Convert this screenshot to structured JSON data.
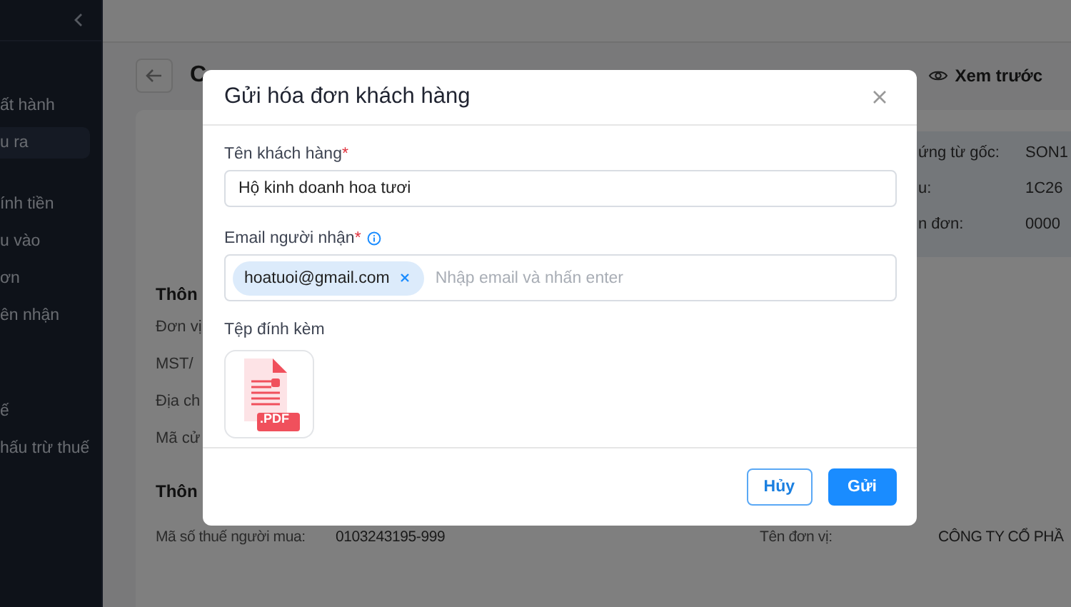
{
  "sidebar": {
    "groups": [
      {
        "items": [
          {
            "label": "ất hành",
            "selected": false
          },
          {
            "label": "u ra",
            "selected": true
          }
        ]
      },
      {
        "items": [
          {
            "label": "ính tiền",
            "selected": false
          },
          {
            "label": "u vào",
            "selected": false
          },
          {
            "label": "ơn",
            "selected": false
          },
          {
            "label": "ên nhận",
            "selected": false
          }
        ]
      },
      {
        "items": [
          {
            "label": "ế",
            "selected": false
          },
          {
            "label": "hấu trừ thuế",
            "selected": false
          }
        ]
      }
    ]
  },
  "page": {
    "title": "C",
    "preview_button": "Xem trước",
    "info_card": {
      "rows": [
        {
          "label": "ứng từ gốc:",
          "value": "SON1"
        },
        {
          "label": "u:",
          "value": "1C26"
        },
        {
          "label": "n đơn:",
          "value": "0000"
        }
      ]
    },
    "sections": [
      {
        "heading": "Thôn",
        "rows": [
          {
            "label": "Đơn vị"
          },
          {
            "label": "MST/"
          },
          {
            "label": "Địa ch"
          },
          {
            "label": "Mã cử"
          }
        ]
      },
      {
        "heading": "Thôn",
        "rows": [
          {
            "label": "Mã số thuế người mua:",
            "value": "0103243195-999",
            "label_2": "Tên đơn vị:",
            "value_2": "CÔNG TY CỔ PHẦ"
          }
        ]
      }
    ]
  },
  "modal": {
    "title": "Gửi hóa đơn khách hàng",
    "fields": [
      {
        "kind": "text",
        "label": "Tên khách hàng",
        "required_mark": "*",
        "value": "Hộ kinh doanh hoa tươi"
      },
      {
        "kind": "tags",
        "label": "Email người nhận",
        "required_mark": "*",
        "info": true,
        "tags": [
          "hoatuoi@gmail.com"
        ],
        "placeholder": "Nhập email và nhấn enter"
      }
    ],
    "attachments_label": "Tệp đính kèm",
    "attachments": [
      {
        "badge": ".PDF"
      }
    ],
    "buttons": [
      {
        "label": "Hủy",
        "kind": "secondary"
      },
      {
        "label": "Gửi",
        "kind": "primary"
      }
    ]
  }
}
